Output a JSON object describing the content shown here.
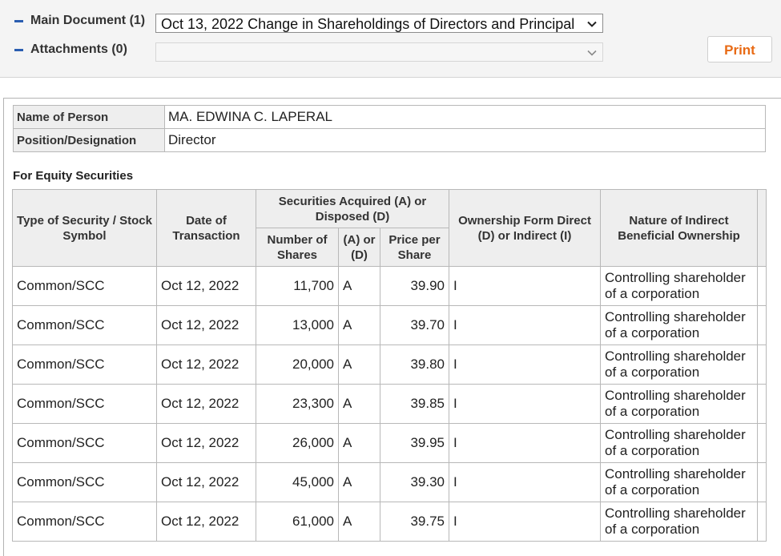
{
  "toolbar": {
    "main_document_label": "Main Document (1)",
    "main_document_value": "Oct 13, 2022  Change in Shareholdings of Directors and Principal",
    "attachments_label": "Attachments (0)",
    "attachments_value": "",
    "print_label": "Print"
  },
  "person": {
    "name_label": "Name of Person",
    "name_value": "MA. EDWINA C. LAPERAL",
    "position_label": "Position/Designation",
    "position_value": "Director"
  },
  "equity": {
    "section_title": "For Equity Securities",
    "headers": {
      "type": "Type of Security / Stock Symbol",
      "date": "Date of Transaction",
      "acquired_disposed": "Securities Acquired (A) or Disposed (D)",
      "number": "Number of Shares",
      "ad": "(A) or (D)",
      "price": "Price per Share",
      "ownership": "Ownership Form Direct (D) or Indirect (I)",
      "nature": "Nature of Indirect Beneficial Ownership"
    },
    "rows": [
      {
        "type": "Common/SCC",
        "date": "Oct 12, 2022",
        "number": "11,700",
        "ad": "A",
        "price": "39.90",
        "ownership": "I",
        "nature": "Controlling shareholder of a corporation"
      },
      {
        "type": "Common/SCC",
        "date": "Oct 12, 2022",
        "number": "13,000",
        "ad": "A",
        "price": "39.70",
        "ownership": "I",
        "nature": "Controlling shareholder of a corporation"
      },
      {
        "type": "Common/SCC",
        "date": "Oct 12, 2022",
        "number": "20,000",
        "ad": "A",
        "price": "39.80",
        "ownership": "I",
        "nature": "Controlling shareholder of a corporation"
      },
      {
        "type": "Common/SCC",
        "date": "Oct 12, 2022",
        "number": "23,300",
        "ad": "A",
        "price": "39.85",
        "ownership": "I",
        "nature": "Controlling shareholder of a corporation"
      },
      {
        "type": "Common/SCC",
        "date": "Oct 12, 2022",
        "number": "26,000",
        "ad": "A",
        "price": "39.95",
        "ownership": "I",
        "nature": "Controlling shareholder of a corporation"
      },
      {
        "type": "Common/SCC",
        "date": "Oct 12, 2022",
        "number": "45,000",
        "ad": "A",
        "price": "39.30",
        "ownership": "I",
        "nature": "Controlling shareholder of a corporation"
      },
      {
        "type": "Common/SCC",
        "date": "Oct 12, 2022",
        "number": "61,000",
        "ad": "A",
        "price": "39.75",
        "ownership": "I",
        "nature": "Controlling shareholder of a corporation"
      }
    ]
  },
  "colors": {
    "accent_dash": "#2a5db0",
    "print_text": "#e86a14"
  }
}
